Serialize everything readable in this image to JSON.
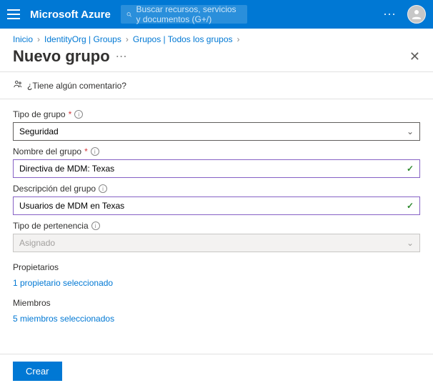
{
  "topbar": {
    "brand": "Microsoft Azure",
    "search_placeholder": "Buscar recursos, servicios y documentos (G+/)"
  },
  "crumbs": {
    "items": [
      "Inicio",
      "IdentityOrg | Groups",
      "Grupos | Todos los grupos"
    ]
  },
  "header": {
    "title": "Nuevo grupo"
  },
  "feedback": {
    "text": "¿Tiene algún comentario?"
  },
  "fields": {
    "groupType": {
      "label": "Tipo de grupo",
      "value": "Seguridad"
    },
    "groupName": {
      "label": "Nombre del grupo",
      "value": "Directiva de MDM: Texas"
    },
    "groupDesc": {
      "label": "Descripción del grupo",
      "value": "Usuarios de MDM en Texas"
    },
    "membership": {
      "label": "Tipo de pertenencia",
      "value": "Asignado"
    }
  },
  "owners": {
    "label": "Propietarios",
    "link": "1 propietario seleccionado"
  },
  "members": {
    "label": "Miembros",
    "link": "5 miembros seleccionados"
  },
  "footer": {
    "create": "Crear"
  }
}
